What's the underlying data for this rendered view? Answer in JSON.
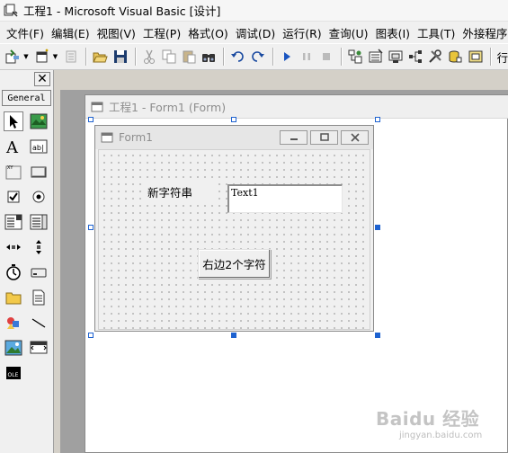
{
  "window": {
    "title": "工程1 - Microsoft Visual Basic [设计]"
  },
  "menubar": {
    "items": [
      "文件(F)",
      "编辑(E)",
      "视图(V)",
      "工程(P)",
      "格式(O)",
      "调试(D)",
      "运行(R)",
      "查询(U)",
      "图表(I)",
      "工具(T)",
      "外接程序(A)"
    ]
  },
  "toolbar": {
    "overflow_text": "行"
  },
  "toolbox": {
    "tab_label": "General",
    "close_glyph": "✕",
    "tools": [
      "pointer",
      "picturebox",
      "label",
      "textbox",
      "frame",
      "commandbutton",
      "checkbox",
      "optionbutton",
      "combobox",
      "listbox",
      "hscrollbar",
      "vscrollbar",
      "timer",
      "drivelistbox",
      "dirlistbox",
      "filelistbox",
      "shape",
      "line",
      "image",
      "data",
      "ole"
    ]
  },
  "designer": {
    "title": "工程1 - Form1 (Form)"
  },
  "form": {
    "title": "Form1",
    "controls": {
      "label1_caption": "新字符串",
      "text1_value": "Text1",
      "command1_caption": "右边2个字符"
    }
  },
  "watermark": {
    "main": "Baidu 经验",
    "sub": "jingyan.baidu.com"
  },
  "colors": {
    "selection_handle": "#1e62d0",
    "mdi_background": "#a0a0a0",
    "form_background": "#f0f0f0"
  }
}
